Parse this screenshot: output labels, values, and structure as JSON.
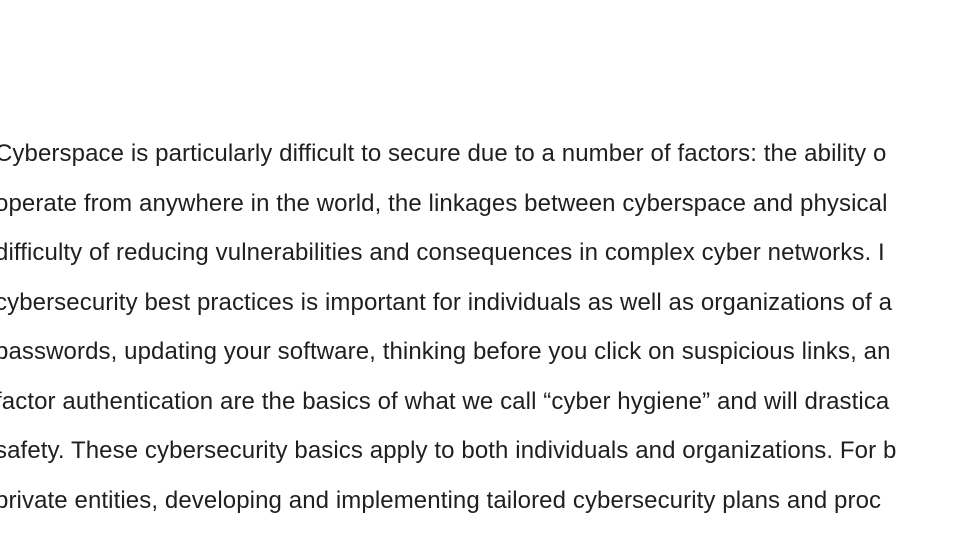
{
  "article": {
    "lines": [
      "Cyberspace is particularly difficult to secure due to a number of factors: the ability o",
      "operate from anywhere in the world, the linkages between cyberspace and physical",
      "difficulty of reducing vulnerabilities and consequences in complex cyber networks. I",
      "cybersecurity best practices is important for individuals as well as organizations of a",
      "passwords, updating your software, thinking before you click on suspicious links, an",
      "factor authentication are the basics of what we call “cyber hygiene” and will drastica",
      "safety. These cybersecurity basics apply to both individuals and organizations. For b",
      "private entities, developing and implementing tailored cybersecurity plans and proc"
    ]
  }
}
